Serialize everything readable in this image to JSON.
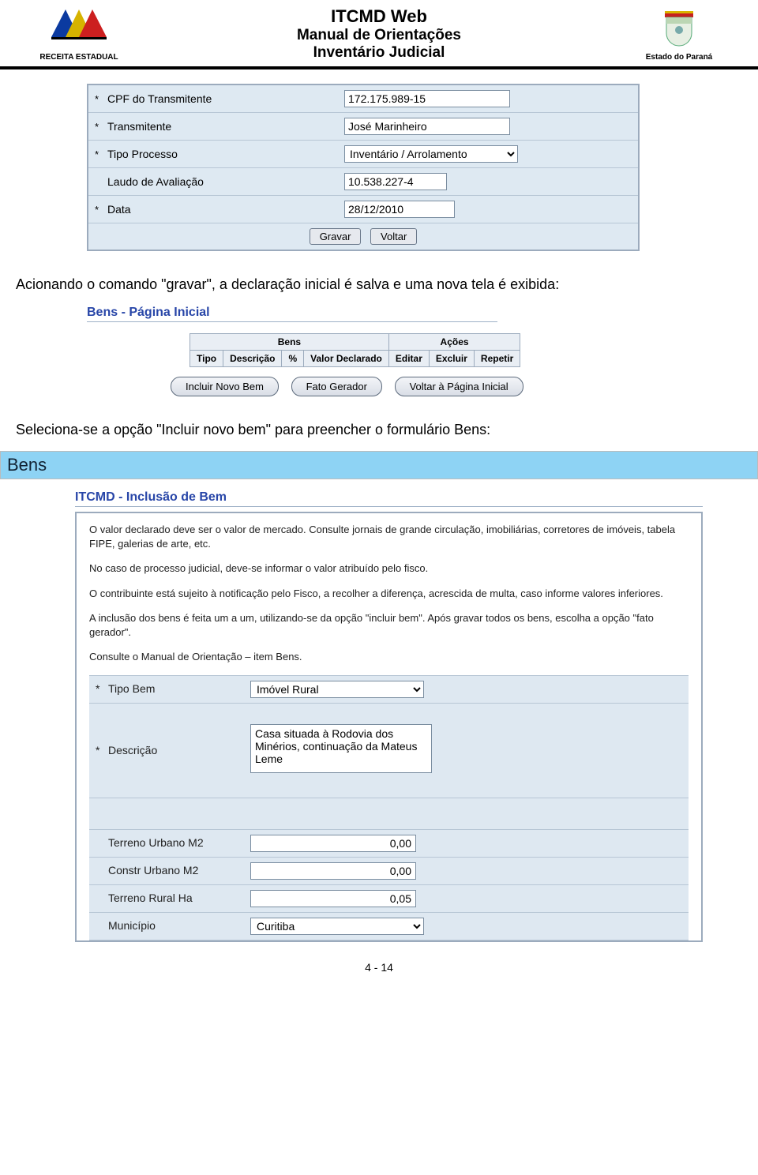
{
  "header": {
    "line1": "ITCMD Web",
    "line2": "Manual de Orientações",
    "line3": "Inventário Judicial",
    "brand_left": "RECEITA ESTADUAL",
    "brand_right": "Estado do Paraná"
  },
  "form1": {
    "rows": [
      {
        "req": "*",
        "label": "CPF do Transmitente",
        "type": "text",
        "value": "172.175.989-15",
        "name": "cpf-transmitente"
      },
      {
        "req": "*",
        "label": "Transmitente",
        "type": "text",
        "value": "José Marinheiro",
        "name": "transmitente"
      },
      {
        "req": "*",
        "label": "Tipo Processo",
        "type": "select",
        "value": "Inventário / Arrolamento",
        "name": "tipo-processo"
      },
      {
        "req": "",
        "label": "Laudo de Avaliação",
        "type": "text",
        "value": "10.538.227-4",
        "name": "laudo-avaliacao",
        "class": "num"
      },
      {
        "req": "*",
        "label": "Data",
        "type": "text",
        "value": "28/12/2010",
        "name": "data",
        "class": "date"
      }
    ],
    "actions": {
      "gravar": "Gravar",
      "voltar": "Voltar"
    }
  },
  "para1": "Acionando o comando \"gravar\", a declaração inicial é salva e uma nova tela é exibida:",
  "bens_page": {
    "title": "Bens - Página Inicial",
    "group_bens": "Bens",
    "group_acoes": "Ações",
    "cols": [
      "Tipo",
      "Descrição",
      "%",
      "Valor Declarado",
      "Editar",
      "Excluir",
      "Repetir"
    ],
    "buttons": {
      "novo": "Incluir Novo Bem",
      "fato": "Fato Gerador",
      "voltar": "Voltar à Página Inicial"
    }
  },
  "para2": "Seleciona-se  a opção \"Incluir novo bem\" para preencher o formulário Bens:",
  "banner": "Bens",
  "inclusao": {
    "title": "ITCMD - Inclusão de Bem",
    "info": [
      "O valor declarado deve ser o valor de mercado. Consulte jornais de grande circulação, imobiliárias, corretores de imóveis, tabela FIPE, galerias de arte, etc.",
      "No caso de processo judicial, deve-se informar o valor atribuído pelo fisco.",
      "O contribuinte está sujeito à notificação pelo Fisco, a recolher a diferença, acrescida de multa, caso informe valores inferiores.",
      "A inclusão dos bens é feita um a um, utilizando-se da opção \"incluir bem\". Após gravar todos os bens, escolha a opção \"fato gerador\".",
      "Consulte o Manual de Orientação – item Bens."
    ],
    "fields": {
      "tipo_bem": {
        "req": "*",
        "label": "Tipo Bem",
        "value": "Imóvel Rural"
      },
      "descricao": {
        "req": "*",
        "label": "Descrição",
        "value": "Casa situada à Rodovia dos Minérios, continuação da Mateus Leme"
      },
      "terreno_urbano": {
        "req": "",
        "label": "Terreno Urbano M2",
        "value": "0,00"
      },
      "constr_urbano": {
        "req": "",
        "label": "Constr Urbano M2",
        "value": "0,00"
      },
      "terreno_rural": {
        "req": "",
        "label": "Terreno Rural Ha",
        "value": "0,05"
      },
      "municipio": {
        "req": "",
        "label": "Município",
        "value": "Curitiba"
      }
    },
    "bold_word": "Bens"
  },
  "page_number": "4 - 14"
}
